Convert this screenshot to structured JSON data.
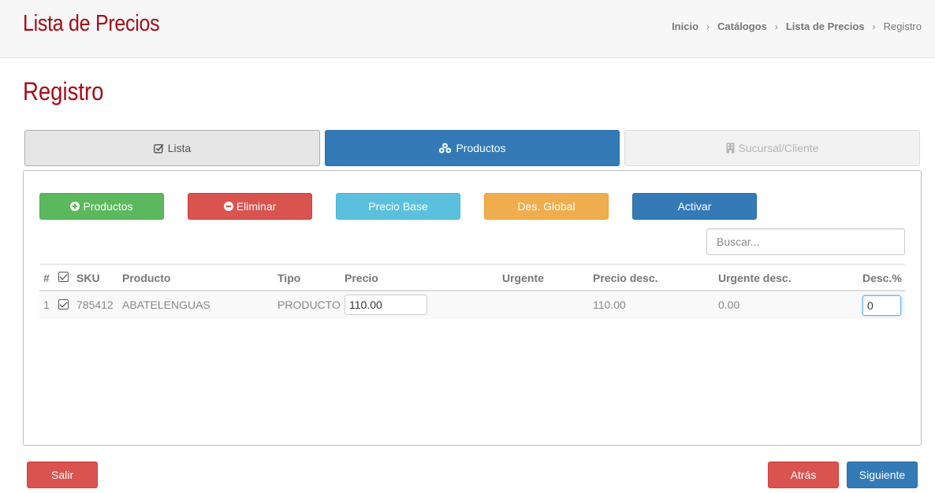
{
  "header": {
    "title": "Lista de Precios",
    "breadcrumb": [
      "Inicio",
      "Catálogos",
      "Lista de Precios"
    ],
    "breadcrumb_current": "Registro",
    "separator": "›"
  },
  "section_title": "Registro",
  "tabs": [
    {
      "label": "Lista",
      "icon": "check-square-icon",
      "state": "default"
    },
    {
      "label": "Productos",
      "icon": "cubes-icon",
      "state": "active"
    },
    {
      "label": "Sucursal/Cliente",
      "icon": "building-icon",
      "state": "disabled"
    }
  ],
  "toolbar": {
    "productos_label": "Productos",
    "eliminar_label": "Eliminar",
    "precio_base_label": "Precio Base",
    "des_global_label": "Des. Global",
    "activar_label": "Activar"
  },
  "search": {
    "placeholder": "Buscar...",
    "value": ""
  },
  "table": {
    "columns": [
      "#",
      "",
      "SKU",
      "Producto",
      "Tipo",
      "Precio",
      "Urgente",
      "Precio desc.",
      "Urgente desc.",
      "Desc.%"
    ],
    "rows": [
      {
        "index": "1",
        "checked": true,
        "sku": "785412",
        "producto": "ABATELENGUAS",
        "tipo": "PRODUCTO",
        "precio": "110.00",
        "urgente": "",
        "precio_desc": "110.00",
        "urgente_desc": "0.00",
        "desc_pct": "0"
      }
    ]
  },
  "footer": {
    "salir_label": "Salir",
    "atras_label": "Atrás",
    "siguiente_label": "Siguiente"
  },
  "colors": {
    "brand_red": "#a30d16",
    "primary": "#337ab7",
    "success": "#5cb85c",
    "danger": "#d9534f",
    "info": "#5bc0de",
    "warning": "#f0ad4e"
  }
}
